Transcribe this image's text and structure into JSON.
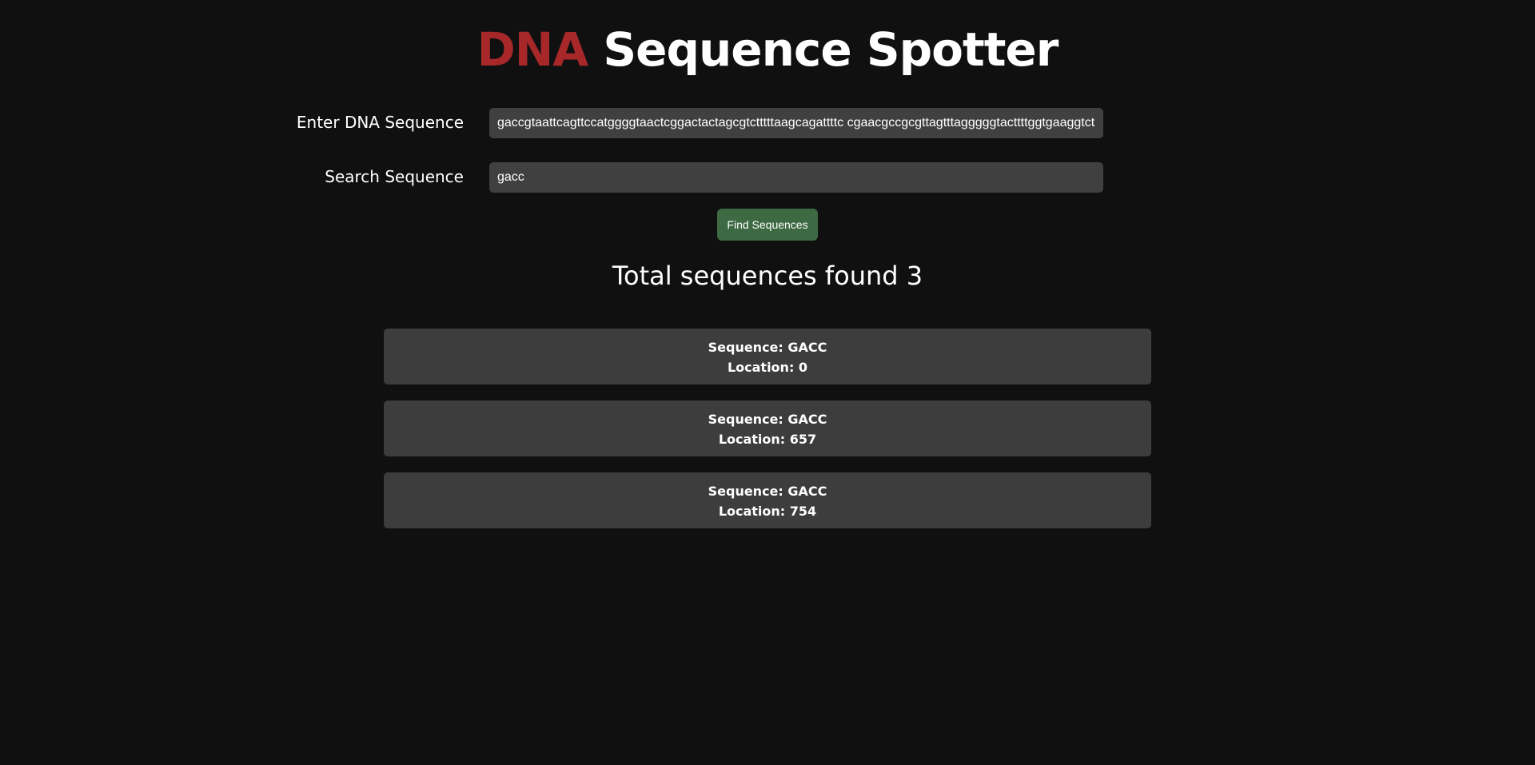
{
  "header": {
    "title_accent": "DNA",
    "title_rest": "Sequence Spotter"
  },
  "form": {
    "dna_label": "Enter DNA Sequence",
    "dna_value": "gaccgtaattcagttccatggggtaactcggactactagcgtctttttaagcagattttc cgaacgccgcgttagtttagggggtacttttggtgaaggtct",
    "search_label": "Search Sequence",
    "search_value": "gacc",
    "find_button_label": "Find Sequences"
  },
  "summary": {
    "total_text": "Total sequences found 3"
  },
  "results": [
    {
      "sequence": "Sequence: GACC",
      "location": "Location: 0"
    },
    {
      "sequence": "Sequence: GACC",
      "location": "Location: 657"
    },
    {
      "sequence": "Sequence: GACC",
      "location": "Location: 754"
    }
  ],
  "colors": {
    "background": "#101010",
    "accent": "#a8282a",
    "input_bg": "#404040",
    "button_bg": "#3d6a43",
    "card_bg": "#3d3d3d"
  }
}
